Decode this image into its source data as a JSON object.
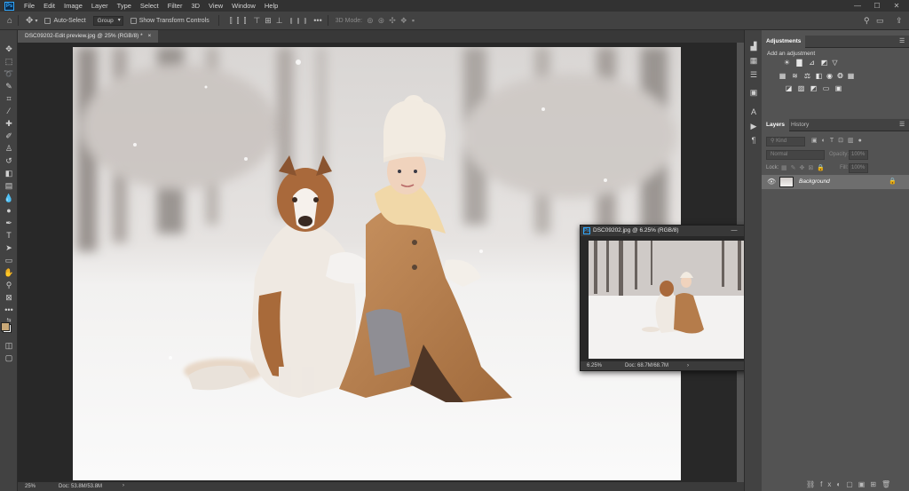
{
  "app": {
    "logo": "Ps"
  },
  "menu": [
    "File",
    "Edit",
    "Image",
    "Layer",
    "Type",
    "Select",
    "Filter",
    "3D",
    "View",
    "Window",
    "Help"
  ],
  "window_controls": {
    "minimize": "—",
    "maximize": "☐",
    "close": "✕"
  },
  "options": {
    "auto_select_label": "Auto-Select",
    "auto_select_target": "Group",
    "show_transform_label": "Show Transform Controls",
    "mode_3d_label": "3D Mode:"
  },
  "document": {
    "tab_label": "DSC09202-Edit preview.jpg @ 25% (RGB/8) *",
    "tab_close": "×",
    "zoom": "25%",
    "doc_size": "Doc: 53.8M/53.8M",
    "status_arrow": "›"
  },
  "floating_window": {
    "title": "DSC09202.jpg @ 6.25% (RGB/8)",
    "zoom": "6.25%",
    "doc_size": "Doc: 68.7M/68.7M",
    "status_arrow": "›"
  },
  "adjustments": {
    "tab": "Adjustments",
    "hint": "Add an adjustment",
    "icons": [
      [
        "brightness-icon",
        "levels-icon",
        "curves-icon",
        "exposure-icon",
        "triangle-icon"
      ],
      [
        "vibrance-icon",
        "hue-icon",
        "balance-icon",
        "bw-icon",
        "photo-filter-icon",
        "mixer-icon",
        "lookup-icon"
      ],
      [
        "invert-icon",
        "posterize-icon",
        "threshold-icon",
        "gradient-map-icon",
        "selective-color-icon"
      ]
    ]
  },
  "layers": {
    "tabs": [
      "Layers",
      "History"
    ],
    "kind_placeholder": "Kind",
    "blend_mode": "Normal",
    "opacity_label": "Opacity:",
    "opacity_value": "100%",
    "lock_label": "Lock:",
    "fill_label": "Fill:",
    "fill_value": "100%",
    "items": [
      {
        "name": "Background",
        "visible": true,
        "locked": true
      }
    ]
  },
  "colors": {
    "foreground": "#c8a877",
    "background": "#ffffff",
    "accent": "#31a8ff"
  }
}
